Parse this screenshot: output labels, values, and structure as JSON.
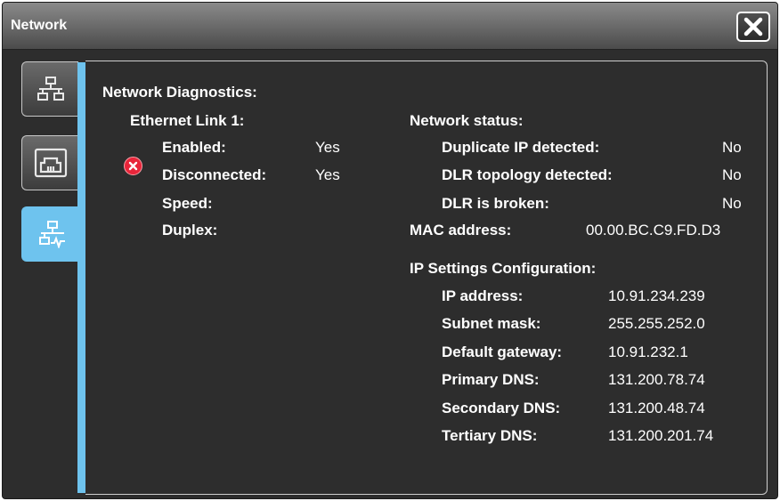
{
  "window": {
    "title": "Network"
  },
  "tabs": [
    {
      "name": "network-topology",
      "active": false
    },
    {
      "name": "ethernet-port",
      "active": false
    },
    {
      "name": "network-diagnostics",
      "active": true
    }
  ],
  "diagnostics": {
    "heading": "Network Diagnostics:",
    "ethernet_link": {
      "heading": "Ethernet Link 1:",
      "enabled_label": "Enabled:",
      "enabled_value": "Yes",
      "disconnected_label": "Disconnected:",
      "disconnected_value": "Yes",
      "speed_label": "Speed:",
      "speed_value": "",
      "duplex_label": "Duplex:",
      "duplex_value": ""
    },
    "network_status": {
      "heading": "Network status:",
      "dup_ip_label": "Duplicate IP detected:",
      "dup_ip_value": "No",
      "dlr_topology_label": "DLR topology detected:",
      "dlr_topology_value": "No",
      "dlr_broken_label": "DLR is broken:",
      "dlr_broken_value": "No"
    },
    "mac": {
      "label": "MAC address:",
      "value": "00.00.BC.C9.FD.D3"
    },
    "ip_settings": {
      "heading": "IP Settings Configuration:",
      "ip_label": "IP address:",
      "ip_value": "10.91.234.239",
      "subnet_label": "Subnet mask:",
      "subnet_value": "255.255.252.0",
      "gateway_label": "Default gateway:",
      "gateway_value": "10.91.232.1",
      "primary_dns_label": "Primary DNS:",
      "primary_dns_value": "131.200.78.74",
      "secondary_dns_label": "Secondary DNS:",
      "secondary_dns_value": "131.200.48.74",
      "tertiary_dns_label": "Tertiary DNS:",
      "tertiary_dns_value": "131.200.201.74"
    }
  },
  "colors": {
    "accent": "#6ec3ee",
    "error": "#e8253a",
    "background": "#2d2d2d"
  }
}
